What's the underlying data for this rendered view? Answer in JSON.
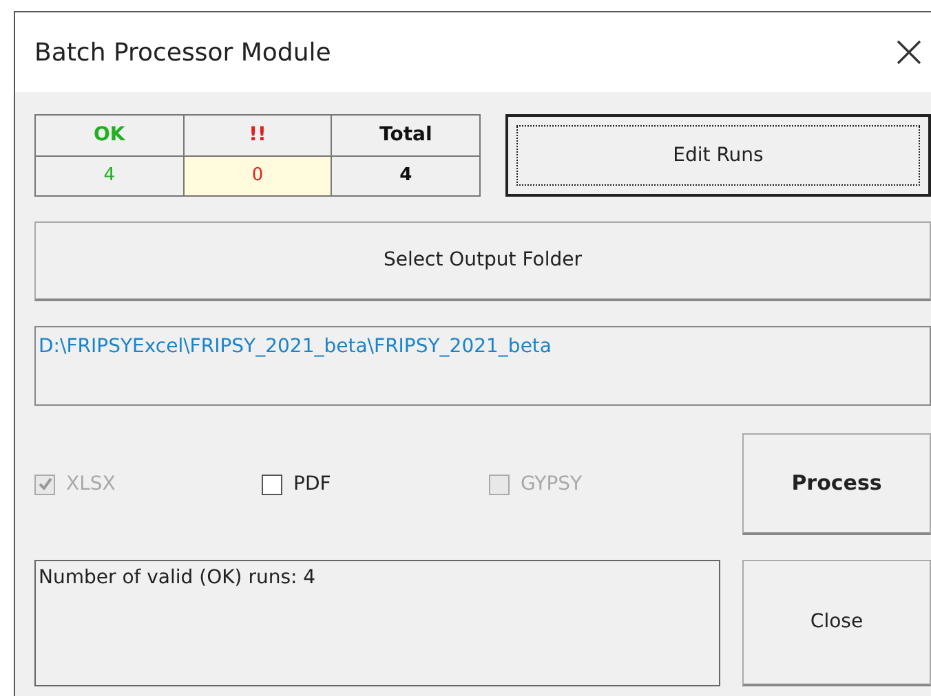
{
  "window": {
    "title": "Batch Processor Module"
  },
  "counts": [
    {
      "label": "OK",
      "value": "4",
      "color": "#22b022",
      "bold": false,
      "highlighted": false
    },
    {
      "label": "!!",
      "value": "0",
      "color": "#e02020",
      "bold": false,
      "highlighted": true
    },
    {
      "label": "Total",
      "value": "4",
      "color": "#111111",
      "bold": true,
      "highlighted": false
    }
  ],
  "edit_runs_button": {
    "label": "Edit Runs",
    "focused": true
  },
  "select_folder_button": {
    "label": "Select Output Folder"
  },
  "output_path": "D:\\FRIPSYExcel\\FRIPSY_2021_beta\\FRIPSY_2021_beta",
  "options": [
    {
      "label": "XLSX",
      "checked": true,
      "disabled": true
    },
    {
      "label": "PDF",
      "checked": false,
      "disabled": false
    },
    {
      "label": "GYPSY",
      "checked": false,
      "disabled": true
    }
  ],
  "process_button": {
    "label": "Process"
  },
  "status": "Number of valid (OK) runs: 4",
  "close_button": {
    "label": "Close"
  }
}
